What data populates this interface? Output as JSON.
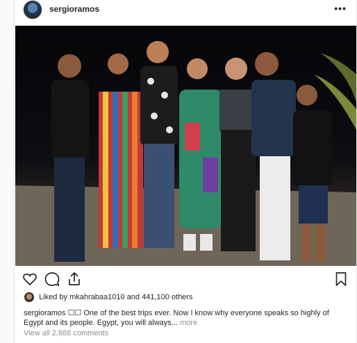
{
  "post": {
    "username": "sergioramos",
    "more_label": "•••",
    "photo_icon": "group-photo",
    "liked_by_prefix": "Liked by ",
    "liked_by_user": "mkahrabaa1010",
    "liked_by_suffix": " and 441,100 others",
    "caption_user": "sergioramos",
    "caption_text": " ☐☐ One of the best trips ever. Now I know why everyone speaks so highly of Egypt and its people. Egypt, you will always...",
    "caption_more": " more",
    "view_comments": "View all 2,888 comments"
  },
  "icons": {
    "heart": "heart-icon",
    "comment": "comment-icon",
    "share": "share-icon",
    "save": "bookmark-icon"
  },
  "colors": {
    "text": "#262626",
    "muted": "#8e8e8e",
    "background": "#fafafa"
  }
}
